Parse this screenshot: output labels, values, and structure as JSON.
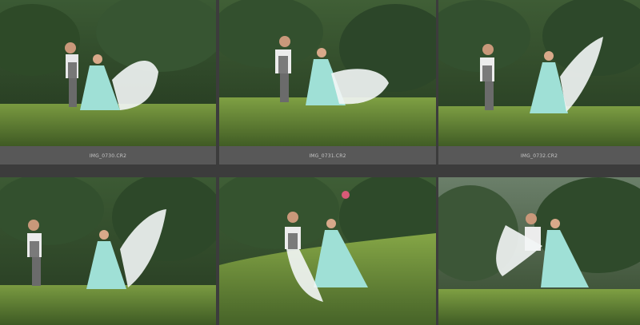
{
  "grid": {
    "cells": [
      {
        "caption": "IMG_0730.CR2"
      },
      {
        "caption": "IMG_0731.CR2"
      },
      {
        "caption": "IMG_0732.CR2"
      },
      {
        "caption": ""
      },
      {
        "caption": ""
      },
      {
        "caption": ""
      }
    ]
  },
  "colors": {
    "background": "#3c3c3c",
    "cell": "#545454",
    "caption_text": "#c8c8c8",
    "foliage_dark": "#2f4a24",
    "foliage_light": "#6d8b3c",
    "dress": "#9fe0d6"
  }
}
